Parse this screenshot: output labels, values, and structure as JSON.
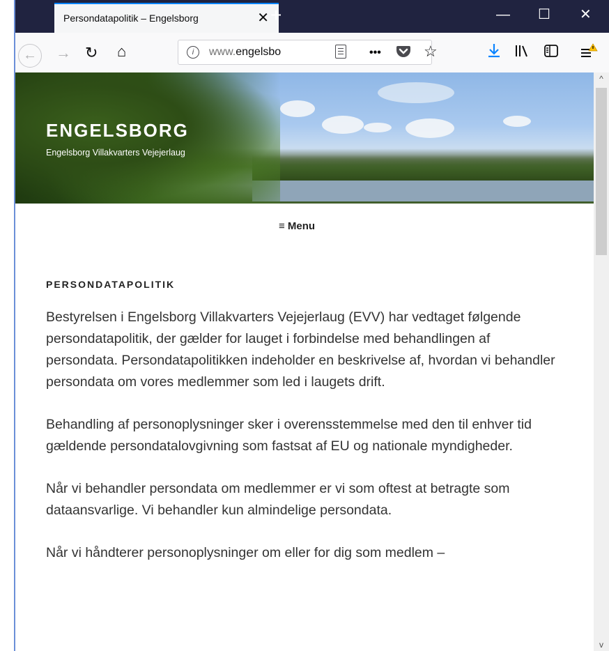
{
  "browser": {
    "tab_title": "Persondatapolitik – Engelsborg",
    "tab_close": "✕",
    "new_tab": "+",
    "minimize": "—",
    "maximize": "☐",
    "close": "✕",
    "url_prefix": "www.",
    "url_domain": "engelsbo",
    "more": "•••"
  },
  "site": {
    "title": "ENGELSBORG",
    "description": "Engelsborg Villakvarters Vejejerlaug",
    "menu_label": "≡ Menu"
  },
  "page": {
    "heading": "PERSONDATAPOLITIK",
    "paragraphs": [
      "Bestyrelsen i Engelsborg Villakvarters Vejejerlaug (EVV) har vedtaget følgende persondatapolitik, der gælder for lauget i forbindelse med behandlingen af persondata. Persondatapolitikken indeholder en beskrivelse af, hvordan vi behandler persondata om vores medlemmer som led i laugets drift.",
      "Behandling af personoplysninger sker i overensstemmelse med den til enhver tid gældende persondatalovgivning som fastsat af EU og nationale myndigheder.",
      "Når vi behandler persondata om medlemmer er vi som oftest at betragte som dataansvarlige. Vi behandler kun almindelige persondata.",
      "Når vi håndterer personoplysninger om eller for dig som medlem –"
    ]
  }
}
